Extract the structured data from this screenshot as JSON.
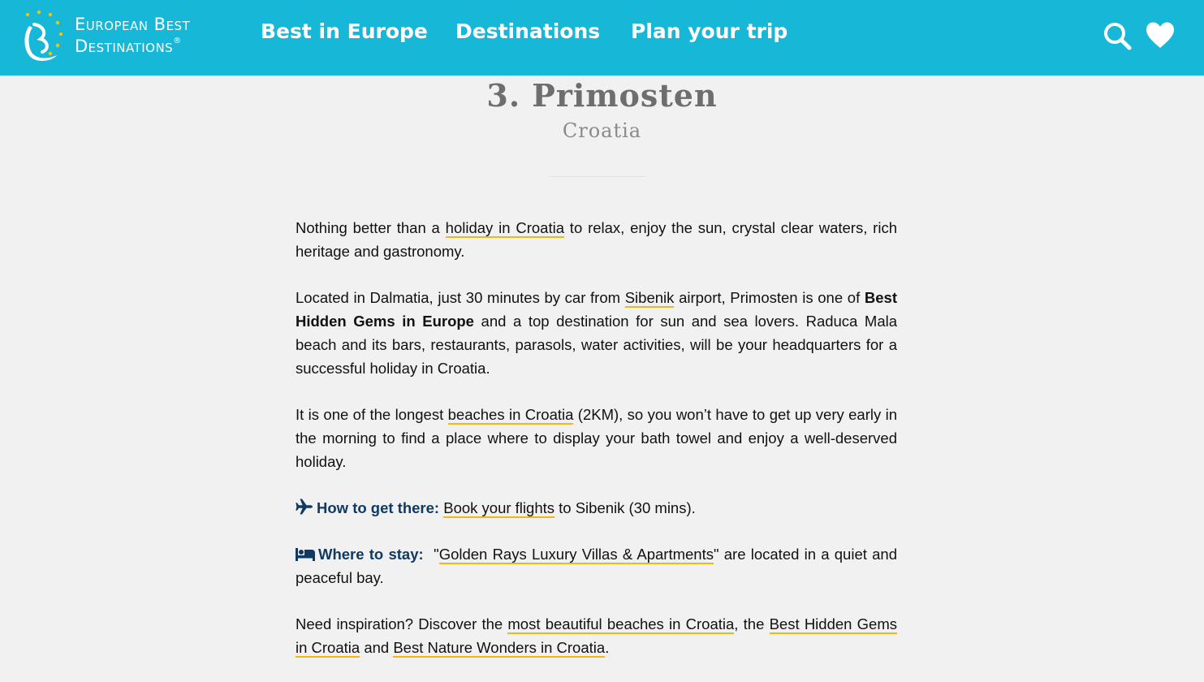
{
  "header": {
    "logo": {
      "line1": "European Best",
      "line2": "Destinations",
      "reg": "®"
    },
    "nav": [
      {
        "label": "Best in Europe"
      },
      {
        "label": "Destinations"
      },
      {
        "label": "Plan your trip"
      }
    ],
    "icons": {
      "search": "search-icon",
      "favorites": "heart-icon"
    },
    "colors": {
      "bar": "#17b7d8",
      "accent_underline": "#f2b617",
      "label": "#0f3a63"
    }
  },
  "article": {
    "title": "3. Primosten",
    "subtitle": "Croatia",
    "p1": {
      "t1": "Nothing better than a ",
      "link1": "holiday in Croatia",
      "t2": " to relax, enjoy the sun, crystal clear waters, rich heritage and gastronomy."
    },
    "p2": {
      "t1": "Located in Dalmatia, just 30 minutes by car from ",
      "link1": "Sibenik",
      "t2": " airport, Primosten is one of ",
      "bold": "Best Hidden Gems in Europe",
      "t3": " and a top destination for sun and sea lovers. Raduca Mala beach and its bars, restaurants, parasols, water activities, will be your headquarters for a successful holiday in Croatia."
    },
    "p3": {
      "t1": "It is one of the longest ",
      "link1": "beaches in Croatia",
      "t2": " (2KM), so you won’t have to get up very early in the morning to find a place where to display your bath towel and enjoy a well-deserved holiday."
    },
    "p4": {
      "label": "How to get there:",
      "link1": "Book your flights",
      "t1": " to Sibenik (30 mins)."
    },
    "p5": {
      "label": "Where to stay:",
      "t0": "  \"",
      "link1": "Golden Rays Luxury Villas & Apartments",
      "t1": "\" are located in a quiet and peaceful bay."
    },
    "p6": {
      "t1": "Need inspiration? Discover the ",
      "link1": "most beautiful beaches in Croatia",
      "t2": ", the ",
      "link2": "Best Hidden Gems in Croatia",
      "t3": " and ",
      "link3": "Best Nature Wonders in Croatia",
      "t4": "."
    }
  }
}
